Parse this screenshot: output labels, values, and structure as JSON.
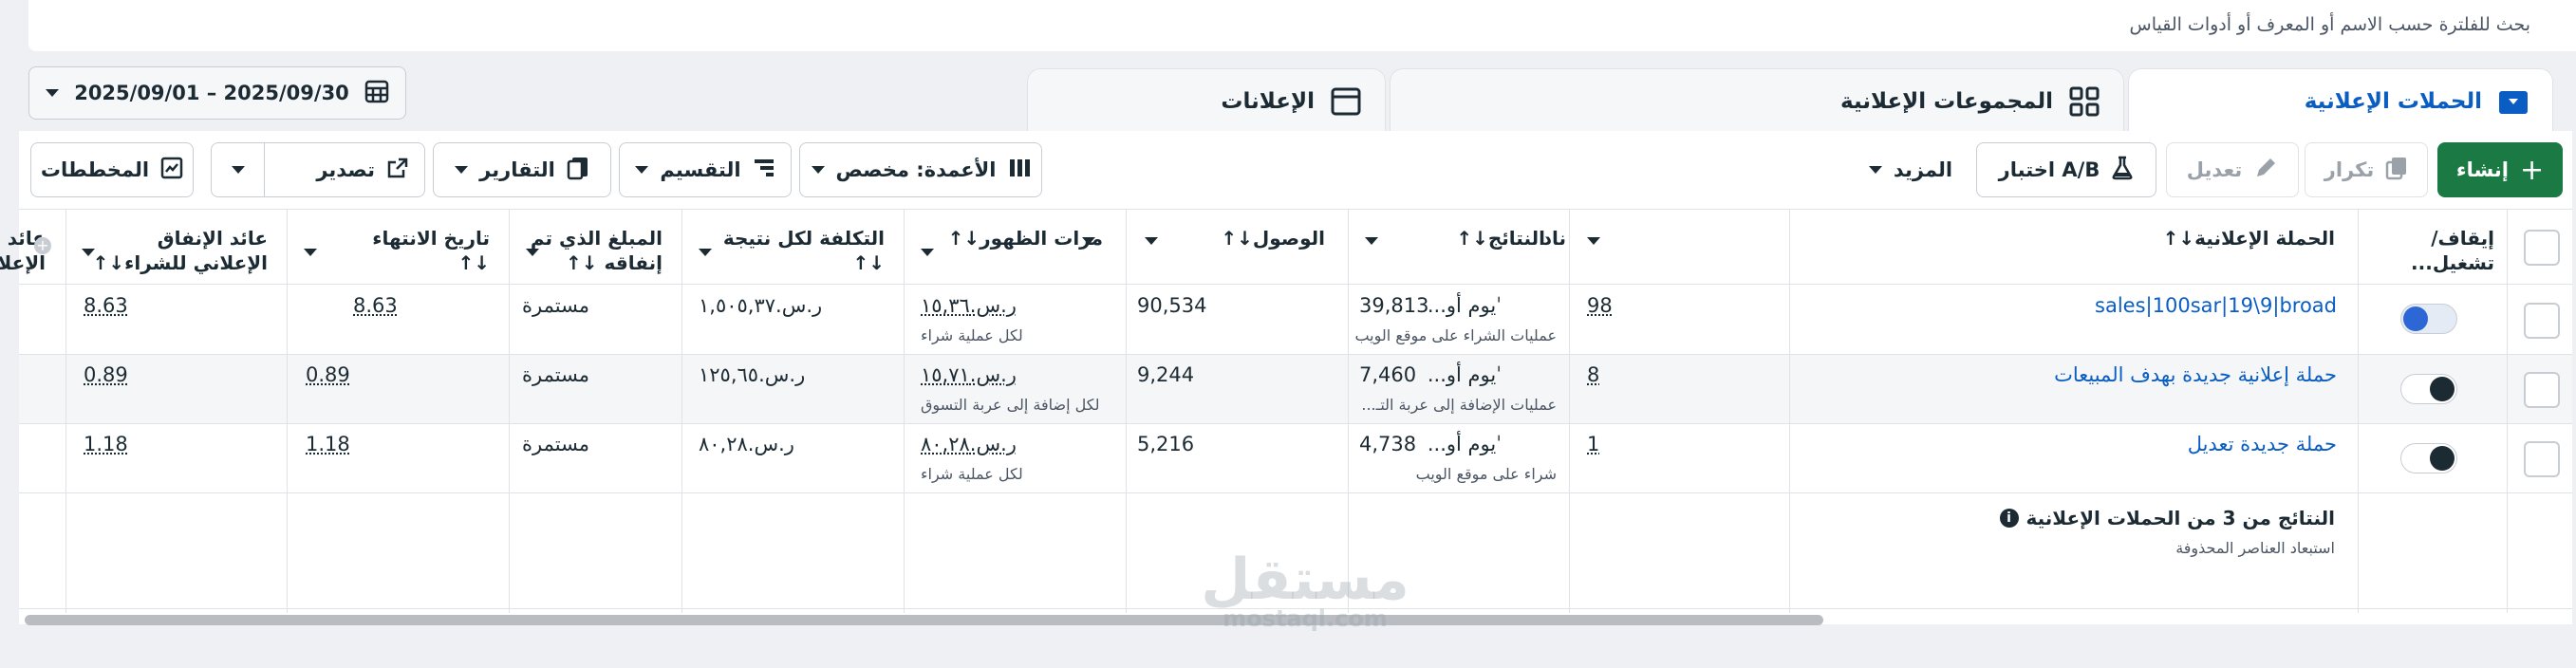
{
  "search": {
    "placeholder": "بحث للفلترة حسب الاسم أو المعرف أو أدوات القياس"
  },
  "tabs": [
    {
      "label": "الحملات الإعلانية",
      "icon": "folder-icon"
    },
    {
      "label": "المجموعات الإعلانية",
      "icon": "grid-icon"
    },
    {
      "label": "الإعلانات",
      "icon": "ad-icon"
    }
  ],
  "date_range": "2025/09/01 – 2025/09/30",
  "toolbar": {
    "create": "إنشاء",
    "duplicate": "تكرار",
    "edit": "تعديل",
    "ab_test": "اختبار A/B",
    "more": "المزيد",
    "columns": "الأعمدة: مخصص",
    "breakdown": "التقسيم",
    "reports": "التقارير",
    "export": "تصدير",
    "charts": "المخططات"
  },
  "table": {
    "headers": {
      "toggle": "إيقاف/ تشغيل...",
      "campaign": "الحملة الإعلانية↓↑",
      "delivery": "ناد",
      "results": "النتائج↓↑",
      "reach": "الوصول↓↑",
      "impressions": "مرات الظهور↓↑",
      "cost_per_result": "التكلفة لكل نتيجة ↓↑",
      "amount_spent": "المبلغ الذي تم إنفاقه ↓↑",
      "end_date": "تاريخ الانتهاء ↓↑",
      "roas1": "عائد الإنفاق الإعلاني للشراء↓↑",
      "roas2": "عائد الإنفاق الإعلاني للشراء..."
    },
    "rows": [
      {
        "on": true,
        "campaign": "sales|100sar|19\\9|broad",
        "delivery": "ˈيوم أو...",
        "results": "98",
        "results_sub": "عمليات الشراء على موقع الويب",
        "reach": "39,813",
        "impressions": "90,534",
        "cost": "ر.س.١٥,٣٦",
        "cost_sub": "لكل عملية شراء",
        "spent": "ر.س.١,٥٠٥,٣٧",
        "end": "مستمرة",
        "roas1": "8.63",
        "roas2": "8.63"
      },
      {
        "on": false,
        "campaign": "حملة إعلانية جديدة بهدف المبيعات",
        "delivery": "ˈيوم أو...",
        "results": "8",
        "results_sub": "عمليات الإضافة إلى عربة التـ...",
        "reach": "7,460",
        "impressions": "9,244",
        "cost": "ر.س.١٥,٧١",
        "cost_sub": "لكل إضافة إلى عربة التسوق",
        "spent": "ر.س.١٢٥,٦٥",
        "end": "مستمرة",
        "roas1": "0.89",
        "roas2": "0.89"
      },
      {
        "on": false,
        "campaign": "حملة جديدة تعديل",
        "delivery": "ˈيوم أو...",
        "results": "1",
        "results_sub": "شراء على موقع الويب",
        "reach": "4,738",
        "impressions": "5,216",
        "cost": "ر.س.٨٠,٢٨",
        "cost_sub": "لكل عملية شراء",
        "spent": "ر.س.٨٠,٢٨",
        "end": "مستمرة",
        "roas1": "1.18",
        "roas2": "1.18"
      }
    ],
    "summary_title": "النتائج من 3 من الحملات الإعلانية",
    "summary_sub": "استبعاد العناصر المحذوفة"
  },
  "watermark": {
    "arabic": "مستقل",
    "latin": "mostaql.com"
  },
  "colors": {
    "accent": "#0a5dc2",
    "primary_button": "#1b7a43",
    "toggle_on": "#2d67d6"
  }
}
